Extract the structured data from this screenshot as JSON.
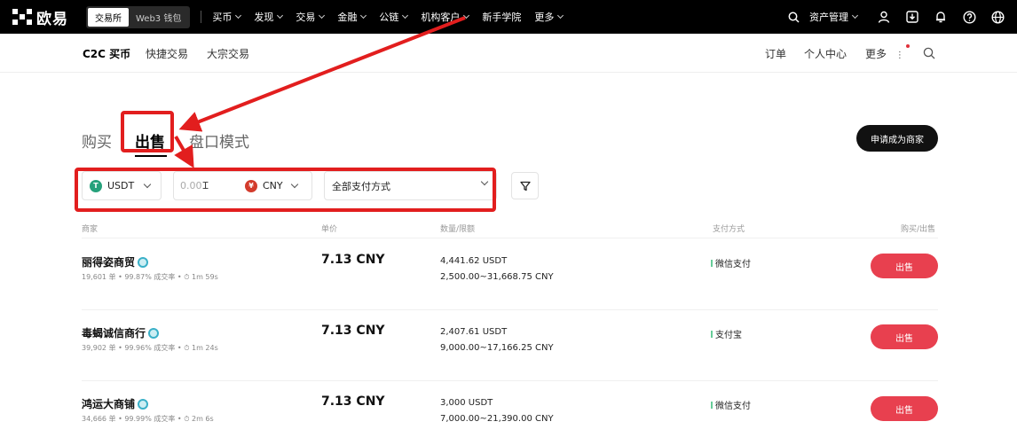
{
  "topnav": {
    "logo": "欧易",
    "segments": [
      "交易所",
      "Web3 钱包"
    ],
    "links": [
      {
        "label": "买币",
        "chevron": true
      },
      {
        "label": "发现",
        "chevron": true
      },
      {
        "label": "交易",
        "chevron": true
      },
      {
        "label": "金融",
        "chevron": true
      },
      {
        "label": "公链",
        "chevron": true
      },
      {
        "label": "机构客户",
        "chevron": true
      },
      {
        "label": "新手学院",
        "chevron": false
      },
      {
        "label": "更多",
        "chevron": true
      }
    ],
    "asset_label": "资产管理",
    "icons": [
      "search-icon",
      "user-icon",
      "download-icon",
      "bell-icon",
      "help-icon",
      "globe-icon"
    ]
  },
  "subnav": {
    "tabs": [
      "C2C 买币",
      "快捷交易",
      "大宗交易"
    ],
    "right": {
      "orders": "订单",
      "personal": "个人中心",
      "more": "更多"
    }
  },
  "main_tabs": {
    "buy": "购买",
    "sell": "出售",
    "book": "盘口模式"
  },
  "merchant_button": "申请成为商家",
  "filters": {
    "crypto": "USDT",
    "crypto_icon": "T",
    "amount_placeholder": "0.00",
    "fiat": "CNY",
    "fiat_icon": "¥",
    "payment": "全部支付方式"
  },
  "table": {
    "headers": {
      "merchant": "商家",
      "price": "单价",
      "qty": "数量/限额",
      "payment": "支付方式",
      "action": "购买/出售"
    },
    "rows": [
      {
        "name": "丽得姿商贸",
        "stats": "19,601 单 • 99.87% 成交率 • ⏱ 1m 59s",
        "price": "7.13 CNY",
        "qty": "4,441.62 USDT",
        "limit": "2,500.00~31,668.75 CNY",
        "payment": "微信支付",
        "action": "出售"
      },
      {
        "name": "毒蝎诚信商行",
        "stats": "39,902 单 • 99.96% 成交率 • ⏱ 1m 24s",
        "price": "7.13 CNY",
        "qty": "2,407.61 USDT",
        "limit": "9,000.00~17,166.25 CNY",
        "payment": "支付宝",
        "action": "出售"
      },
      {
        "name": "鸿运大商铺",
        "stats": "34,666 单 • 99.99% 成交率 • ⏱ 2m 6s",
        "price": "7.13 CNY",
        "qty": "3,000 USDT",
        "limit": "7,000.00~21,390.00 CNY",
        "payment": "微信支付",
        "action": "出售"
      }
    ]
  },
  "colors": {
    "annotation": "#e21e1e",
    "sell_button": "#e8404f",
    "usdt": "#26a17b",
    "cny": "#d33b2c"
  }
}
